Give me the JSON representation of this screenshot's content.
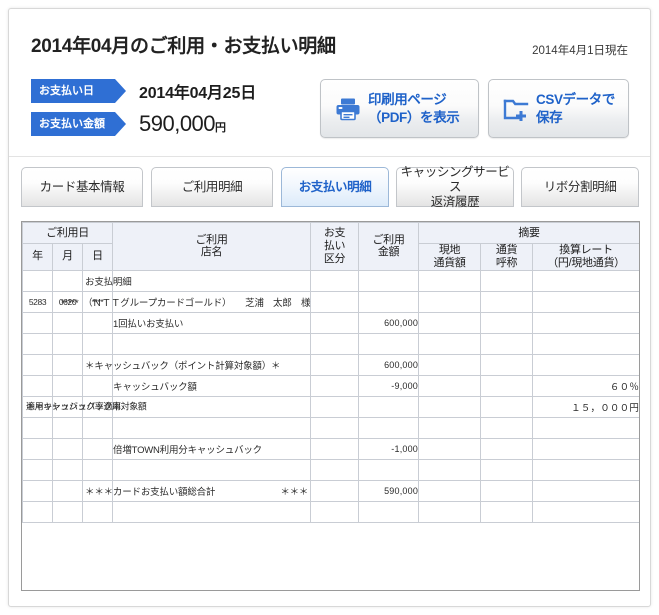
{
  "header": {
    "title": "2014年04月のご利用・お支払い明細",
    "as_of": "2014年4月1日現在",
    "payment_date_label": "お支払い日",
    "payment_date_value": "2014年04月25日",
    "payment_amount_label": "お支払い金額",
    "payment_amount_value": "590,000",
    "payment_amount_unit": "円",
    "accent_color": "#2f6fd4",
    "link_color": "#1f62c9"
  },
  "actions": [
    {
      "name": "print-pdf",
      "icon": "printer-icon",
      "label": "印刷用ページ\n（PDF）を表示"
    },
    {
      "name": "save-csv",
      "icon": "folder-plus-icon",
      "label": "CSVデータで\n保存"
    }
  ],
  "tabs": [
    {
      "label": "カード基本情報",
      "active": false
    },
    {
      "label": "ご利用明細",
      "active": false
    },
    {
      "label": "お支払い明細",
      "active": true
    },
    {
      "label": "キャッシングサービス\n返済履歴",
      "active": false
    },
    {
      "label": "リボ分割明細",
      "active": false
    }
  ],
  "table": {
    "headers": {
      "use_date": "ご利用日",
      "year": "年",
      "month": "月",
      "day": "日",
      "shop": "ご利用\n店名",
      "payment_type": "お支\n払い\n区分",
      "amount": "ご利用\n金額",
      "summary": "摘要",
      "local_amount": "現地\n通貨額",
      "currency": "通貨\n呼称",
      "rate": "換算レート\n（円/現地通貨）"
    },
    "rows": [
      {
        "type": "label",
        "year": "",
        "month": "",
        "day": "",
        "shop": "お支払明細",
        "kubun": "",
        "amount": "",
        "local": "",
        "currency": "",
        "rate": "",
        "bleed": "short"
      },
      {
        "type": "card",
        "year": "5283",
        "month": "0620",
        "day": "****",
        "shop": "*****　（ＮＴＴグループカードゴールド）　　芝浦　太郎　様",
        "kubun": "",
        "amount": "",
        "local": "",
        "currency": "",
        "rate": "",
        "bleed": "long"
      },
      {
        "type": "detail",
        "year": "",
        "month": "",
        "day": "",
        "shop": "1回払いお支払い",
        "kubun": "",
        "amount": "600,000",
        "local": "",
        "currency": "",
        "rate": ""
      },
      {
        "type": "blank",
        "year": "",
        "month": "",
        "day": "",
        "shop": "",
        "kubun": "",
        "amount": "",
        "local": "",
        "currency": "",
        "rate": ""
      },
      {
        "type": "section",
        "year": "",
        "month": "",
        "day": "",
        "shop": "＊キャッシュバック（ポイント計算対象額）＊",
        "kubun": "",
        "amount": "600,000",
        "local": "",
        "currency": "",
        "rate": "",
        "bleed": "short"
      },
      {
        "type": "detail",
        "year": "",
        "month": "",
        "day": "",
        "shop": "キャッシュバック額",
        "kubun": "",
        "amount": "-9,000",
        "local": "",
        "currency": "",
        "rate": "",
        "note": "適用キャッシュバック率",
        "note_value": "６０％"
      },
      {
        "type": "note",
        "year": "",
        "month": "",
        "day": "",
        "shop": "",
        "kubun": "",
        "amount": "",
        "local": "",
        "currency": "",
        "rate": "",
        "note": "キャッシュバック率適用対象額",
        "note_value": "１５，０００円"
      },
      {
        "type": "blank",
        "year": "",
        "month": "",
        "day": "",
        "shop": "",
        "kubun": "",
        "amount": "",
        "local": "",
        "currency": "",
        "rate": ""
      },
      {
        "type": "detail",
        "year": "",
        "month": "",
        "day": "",
        "shop": "倍増TOWN利用分キャッシュバック",
        "kubun": "",
        "amount": "-1,000",
        "local": "",
        "currency": "",
        "rate": ""
      },
      {
        "type": "blank",
        "year": "",
        "month": "",
        "day": "",
        "shop": "",
        "kubun": "",
        "amount": "",
        "local": "",
        "currency": "",
        "rate": ""
      },
      {
        "type": "total",
        "year": "",
        "month": "",
        "day": "",
        "shop": "＊＊＊カードお支払い額総合計　　　　　　　＊＊＊",
        "kubun": "",
        "amount": "590,000",
        "local": "",
        "currency": "",
        "rate": "",
        "bleed": "short"
      },
      {
        "type": "blank",
        "year": "",
        "month": "",
        "day": "",
        "shop": "",
        "kubun": "",
        "amount": "",
        "local": "",
        "currency": "",
        "rate": ""
      }
    ]
  }
}
